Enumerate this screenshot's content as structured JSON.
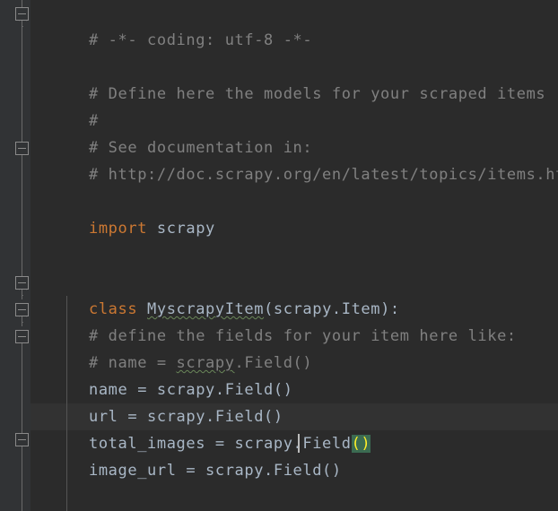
{
  "editor": {
    "language": "Python",
    "theme": "Darcula",
    "colors": {
      "background": "#2b2b2b",
      "gutter_background": "#313335",
      "current_line_background": "#323232",
      "default_text": "#a9b7c6",
      "comment": "#808080",
      "keyword": "#cc7832",
      "bracket_match_background": "#3b6b52",
      "bracket_match_text": "#ffef28",
      "spellcheck_underline": "#6a8759",
      "indent_guide": "#555555",
      "fold_marker": "#8a8a8a"
    },
    "lines": [
      {
        "n": 1,
        "indent": 0,
        "text": "# -*- coding: utf-8 -*-"
      },
      {
        "n": 2,
        "indent": 0,
        "text": ""
      },
      {
        "n": 3,
        "indent": 0,
        "text": "# Define here the models for your scraped items"
      },
      {
        "n": 4,
        "indent": 0,
        "text": "#"
      },
      {
        "n": 5,
        "indent": 0,
        "text": "# See documentation in:"
      },
      {
        "n": 6,
        "indent": 0,
        "text": "# http://doc.scrapy.org/en/latest/topics/items.html"
      },
      {
        "n": 7,
        "indent": 0,
        "text": ""
      },
      {
        "n": 8,
        "indent": 0,
        "text": "import scrapy"
      },
      {
        "n": 9,
        "indent": 0,
        "text": ""
      },
      {
        "n": 10,
        "indent": 0,
        "text": ""
      },
      {
        "n": 11,
        "indent": 0,
        "text": "class MyscrapyItem(scrapy.Item):"
      },
      {
        "n": 12,
        "indent": 1,
        "text": "    # define the fields for your item here like:"
      },
      {
        "n": 13,
        "indent": 1,
        "text": "    # name = scrapy.Field()"
      },
      {
        "n": 14,
        "indent": 1,
        "text": "    name = scrapy.Field()"
      },
      {
        "n": 15,
        "indent": 1,
        "text": "    url = scrapy.Field()"
      },
      {
        "n": 16,
        "indent": 1,
        "text": "    total_images = scrapy.Field()"
      },
      {
        "n": 17,
        "indent": 1,
        "text": "    image_url = scrapy.Field()"
      }
    ],
    "tokens": {
      "comment_coding": "# -*- coding: utf-8 -*-",
      "comment_define": "# Define here the models for your scraped items",
      "comment_hash": "#",
      "comment_see_doc": "# See documentation in:",
      "comment_url": "# http://doc.scrapy.org/en/latest/topics/items.html",
      "kw_import": "import",
      "module_scrapy": "scrapy",
      "kw_class": "class",
      "class_name": "MyscrapyItem",
      "class_bases": "(scrapy.Item):",
      "comment_define_fields": "# define the fields for your item here like:",
      "comment_name_field_prefix": "# name = ",
      "comment_name_field_scrapy": "scrapy",
      "comment_name_field_suffix": ".Field()",
      "field_name": "name = scrapy.Field()",
      "field_url": "url = scrapy.Field()",
      "field_total_images_prefix": "total_images = scrapy.Field",
      "field_total_images_brackets": "()",
      "field_image_url": "image_url = scrapy.Field()"
    },
    "current_line_number": 16,
    "caret_line_number": 17,
    "fold_markers": [
      {
        "line": 1,
        "type": "start",
        "state": "expanded"
      },
      {
        "line": 6,
        "type": "end",
        "state": "expanded"
      },
      {
        "line": 11,
        "type": "start",
        "state": "expanded"
      },
      {
        "line": 12,
        "type": "start",
        "state": "expanded"
      },
      {
        "line": 13,
        "type": "end",
        "state": "expanded"
      },
      {
        "line": 17,
        "type": "end",
        "state": "expanded"
      }
    ]
  }
}
